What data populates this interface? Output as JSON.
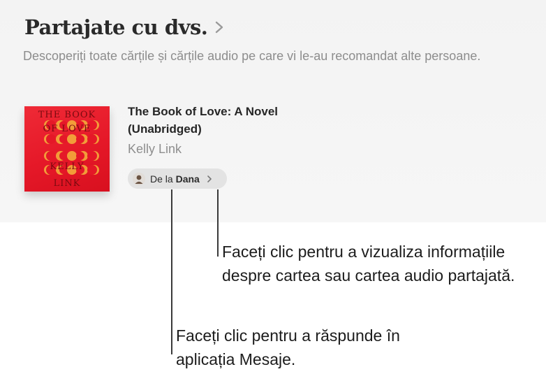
{
  "section": {
    "title": "Partajate cu dvs.",
    "subtitle": "Descoperiți toate cărțile și cărțile audio pe care vi le-au recomandat alte persoane."
  },
  "book": {
    "cover_lines": [
      "THE BOOK",
      "OF LOVE",
      "KELLY",
      "LINK"
    ],
    "title": "The Book of Love: A Novel (Unabridged)",
    "author": "Kelly Link",
    "from_prefix": "De la",
    "from_name": "Dana",
    "icons": {
      "avatar": "person-avatar-icon",
      "pill_chevron": "chevron-right-icon",
      "title_chevron": "chevron-right-icon"
    }
  },
  "callouts": {
    "info": "Faceți clic pentru a vizualiza informațiile despre cartea sau cartea audio partajată.",
    "reply": "Faceți clic pentru a răspunde în aplicația Mesaje."
  },
  "colors": {
    "panel_bg": "#f3f3f3",
    "cover_red": "#e51828",
    "cover_moon": "#f3a43a",
    "pill_bg": "#e3e3e3",
    "subtitle_gray": "#8d8d8d"
  }
}
